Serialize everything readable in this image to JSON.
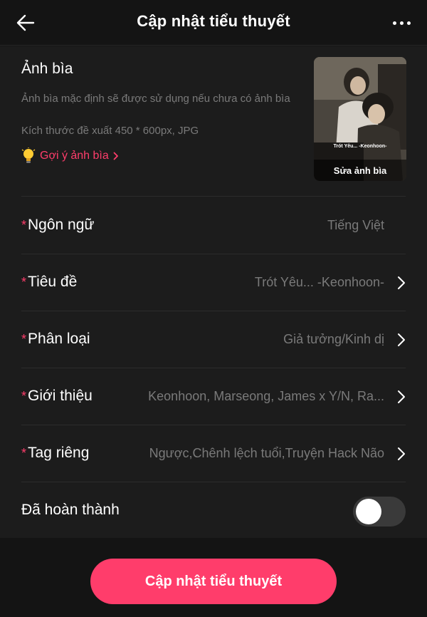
{
  "header": {
    "title": "Cập nhật tiểu thuyết",
    "back_icon": "arrow-left-icon",
    "more_icon": "more-horizontal-icon"
  },
  "cover": {
    "title": "Ảnh bìa",
    "description": "Ảnh bìa mặc định sẽ được sử dụng nếu chưa có ảnh bìa",
    "size_hint": "Kích thước đề xuất 450 * 600px, JPG",
    "suggest_label": "Gợi ý ảnh bìa",
    "suggest_icon": "lightbulb-icon",
    "image_caption": "Trót Yêu... -Keonhoon-",
    "edit_label": "Sửa ảnh bìa"
  },
  "fields": [
    {
      "label": "Ngôn ngữ",
      "value": "Tiếng Việt",
      "required": true,
      "chevron": false
    },
    {
      "label": "Tiêu đề",
      "value": "Trót Yêu... -Keonhoon-",
      "required": true,
      "chevron": true
    },
    {
      "label": "Phân loại",
      "value": "Giả tưởng/Kinh dị",
      "required": true,
      "chevron": true
    },
    {
      "label": "Giới thiệu",
      "value": "Keonhoon, Marseong, James x Y/N, Ra...",
      "required": true,
      "chevron": true
    },
    {
      "label": "Tag riêng",
      "value": "Ngược,Chênh lệch tuổi,Truyện Hack Não",
      "required": true,
      "chevron": true
    }
  ],
  "completed": {
    "label": "Đã hoàn thành",
    "on": false
  },
  "footer": {
    "button_label": "Cập nhật tiểu thuyết"
  },
  "required_mark": "*",
  "colors": {
    "accent": "#ff3d6b",
    "background": "#141414",
    "surface": "#1c1c1c",
    "muted_text": "#7a7a7a"
  }
}
